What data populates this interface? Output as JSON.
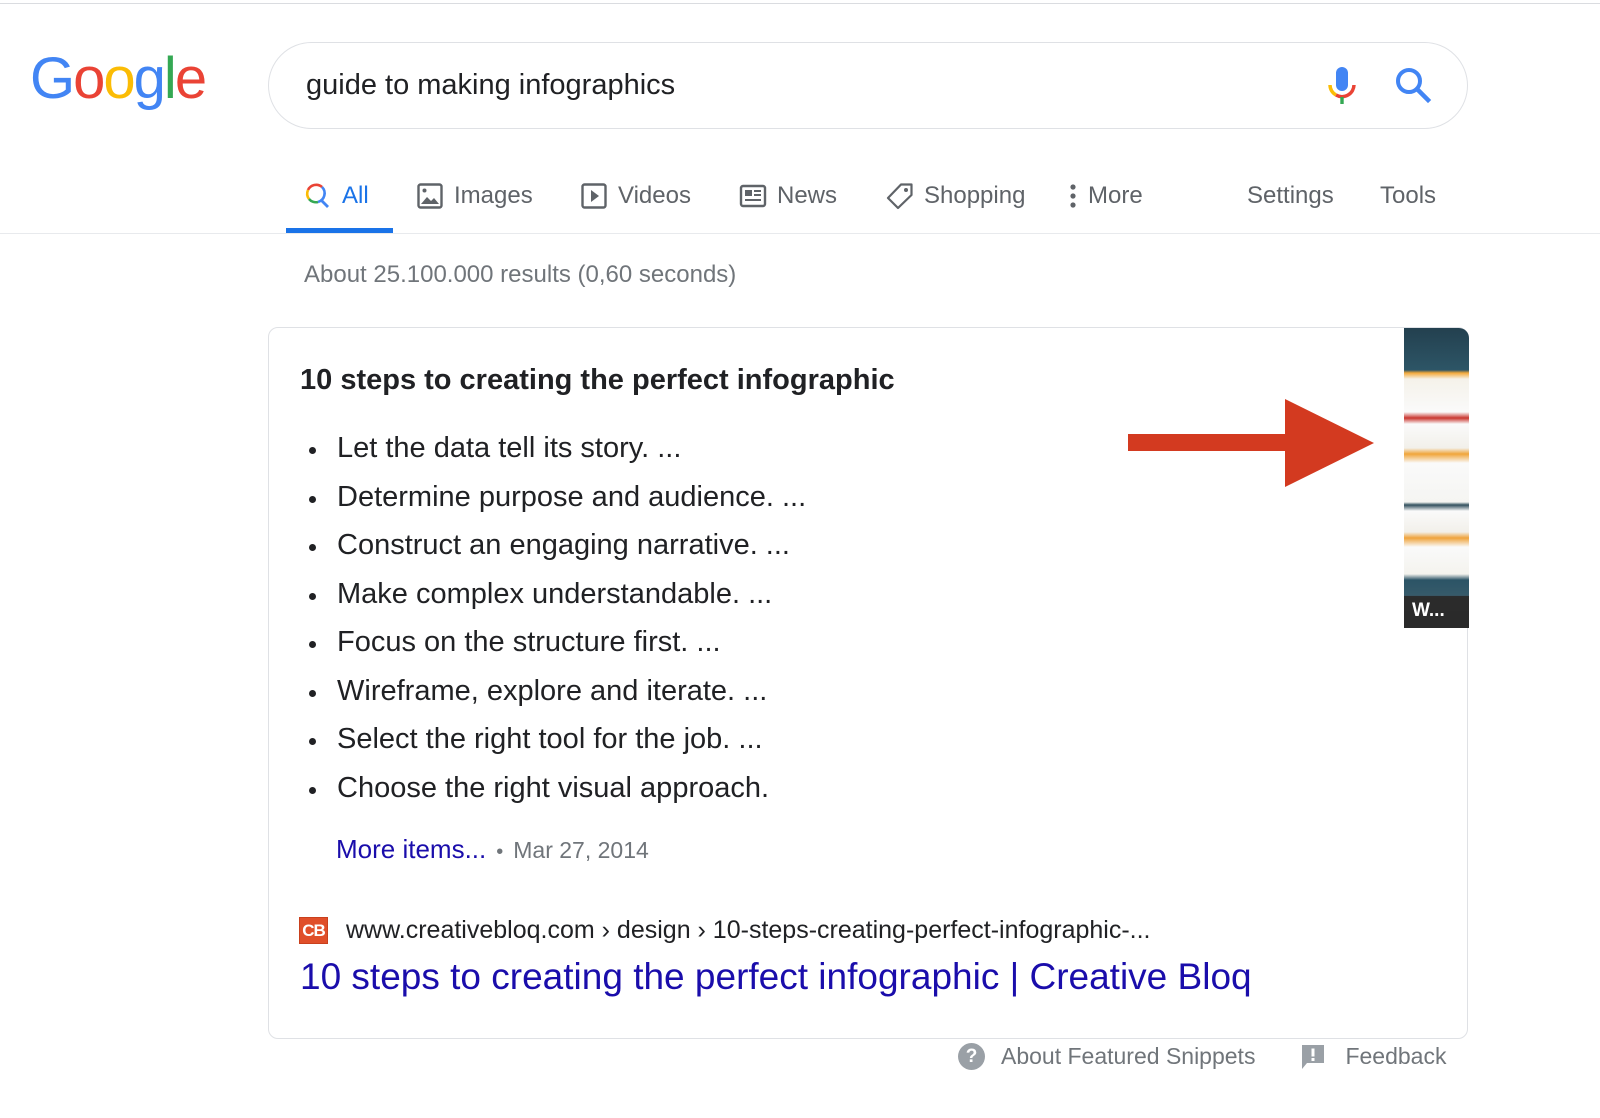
{
  "logo": {
    "letters": [
      "G",
      "o",
      "o",
      "g",
      "l",
      "e"
    ]
  },
  "search": {
    "query": "guide to making infographics",
    "mic_icon": "microphone-icon",
    "search_icon": "search-icon"
  },
  "tabs": [
    {
      "label": "All",
      "icon": "search-icon",
      "active": true
    },
    {
      "label": "Images",
      "icon": "image-icon",
      "active": false
    },
    {
      "label": "Videos",
      "icon": "play-icon",
      "active": false
    },
    {
      "label": "News",
      "icon": "newspaper-icon",
      "active": false
    },
    {
      "label": "Shopping",
      "icon": "tag-icon",
      "active": false
    },
    {
      "label": "More",
      "icon": "more-vertical-icon",
      "active": false
    }
  ],
  "tools": {
    "settings_label": "Settings",
    "tools_label": "Tools"
  },
  "result_stats": "About 25.100.000 results (0,60 seconds)",
  "featured_snippet": {
    "title": "10 steps to creating the perfect infographic",
    "items": [
      "Let the data tell its story. ...",
      "Determine purpose and audience. ...",
      "Construct an engaging narrative. ...",
      "Make complex understandable. ...",
      "Focus on the structure first. ...",
      "Wireframe, explore and iterate. ...",
      "Select the right tool for the job. ...",
      "Choose the right visual approach."
    ],
    "more_items_label": "More items...",
    "separator": "•",
    "date": "Mar 27, 2014",
    "favicon_text": "CB",
    "breadcrumb": "www.creativebloq.com › design › 10-steps-creating-perfect-infographic-...",
    "link_title": "10 steps to creating the perfect infographic | Creative Bloq",
    "thumbnail_caption": "W..."
  },
  "annotation": {
    "arrow_color": "#d33a20"
  },
  "footer": {
    "about_label": "About Featured Snippets",
    "feedback_label": "Feedback"
  },
  "colors": {
    "accent_blue": "#1a73e8",
    "link_blue": "#1a0dab",
    "muted_gray": "#70757a"
  }
}
